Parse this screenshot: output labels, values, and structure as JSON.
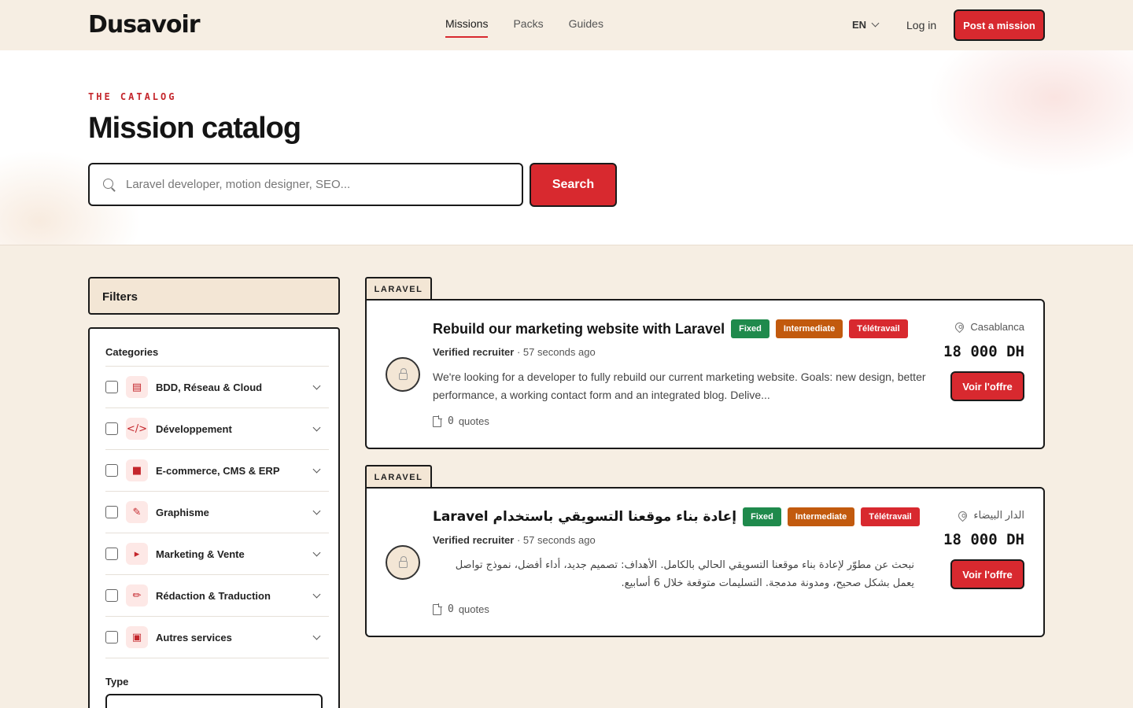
{
  "brand": {
    "logo_text": "Dusavoir"
  },
  "nav": {
    "items": [
      {
        "label": "Missions",
        "active": true
      },
      {
        "label": "Packs",
        "active": false
      },
      {
        "label": "Guides",
        "active": false
      }
    ],
    "lang": "EN",
    "login": "Log in",
    "post_mission": "Post a mission"
  },
  "hero": {
    "eyebrow": "THE CATALOG",
    "title": "Mission catalog",
    "search_placeholder": "Laravel developer, motion designer, SEO...",
    "search_button": "Search"
  },
  "filters": {
    "title": "Filters",
    "categories_title": "Categories",
    "categories": [
      {
        "label": "BDD, Réseau & Cloud",
        "icon": "database-icon"
      },
      {
        "label": "Développement",
        "icon": "code-icon"
      },
      {
        "label": "E-commerce, CMS & ERP",
        "icon": "shopping-bag-icon"
      },
      {
        "label": "Graphisme",
        "icon": "brush-icon"
      },
      {
        "label": "Marketing & Vente",
        "icon": "megaphone-icon"
      },
      {
        "label": "Rédaction & Traduction",
        "icon": "pen-icon"
      },
      {
        "label": "Autres services",
        "icon": "briefcase-icon"
      }
    ],
    "type_title": "Type"
  },
  "missions": [
    {
      "tag": "LARAVEL",
      "title": "Rebuild our marketing website with Laravel",
      "badges": [
        {
          "label": "Fixed",
          "color": "#1f8a4c"
        },
        {
          "label": "Intermediate",
          "color": "#c25a0e"
        },
        {
          "label": "Télétravail",
          "color": "#d8292f"
        }
      ],
      "recruiter": "Verified recruiter",
      "separator": "·",
      "time": "57 seconds ago",
      "description": "We're looking for a developer to fully rebuild our current marketing website. Goals: new design, better performance, a working contact form and an integrated blog. Delive...",
      "quotes_count": "0",
      "quotes_label": "quotes",
      "location": "Casablanca",
      "price": "18 000 DH",
      "cta": "Voir l'offre"
    },
    {
      "tag": "LARAVEL",
      "title": "إعادة بناء موقعنا التسويقي باستخدام Laravel",
      "badges": [
        {
          "label": "Fixed",
          "color": "#1f8a4c"
        },
        {
          "label": "Intermediate",
          "color": "#c25a0e"
        },
        {
          "label": "Télétravail",
          "color": "#d8292f"
        }
      ],
      "recruiter": "Verified recruiter",
      "separator": "·",
      "time": "57 seconds ago",
      "description": "نبحث عن مطوّر لإعادة بناء موقعنا التسويقي الحالي بالكامل. الأهداف: تصميم جديد، أداء أفضل، نموذج تواصل يعمل بشكل صحيح، ومدونة مدمجة. التسليمات متوقعة خلال 6 أسابيع.",
      "quotes_count": "0",
      "quotes_label": "quotes",
      "location": "الدار البيضاء",
      "price": "18 000 DH",
      "cta": "Voir l'offre"
    }
  ],
  "colors": {
    "accent": "#d8292f",
    "background": "#f6eee3",
    "panel": "#f3e6d5"
  }
}
